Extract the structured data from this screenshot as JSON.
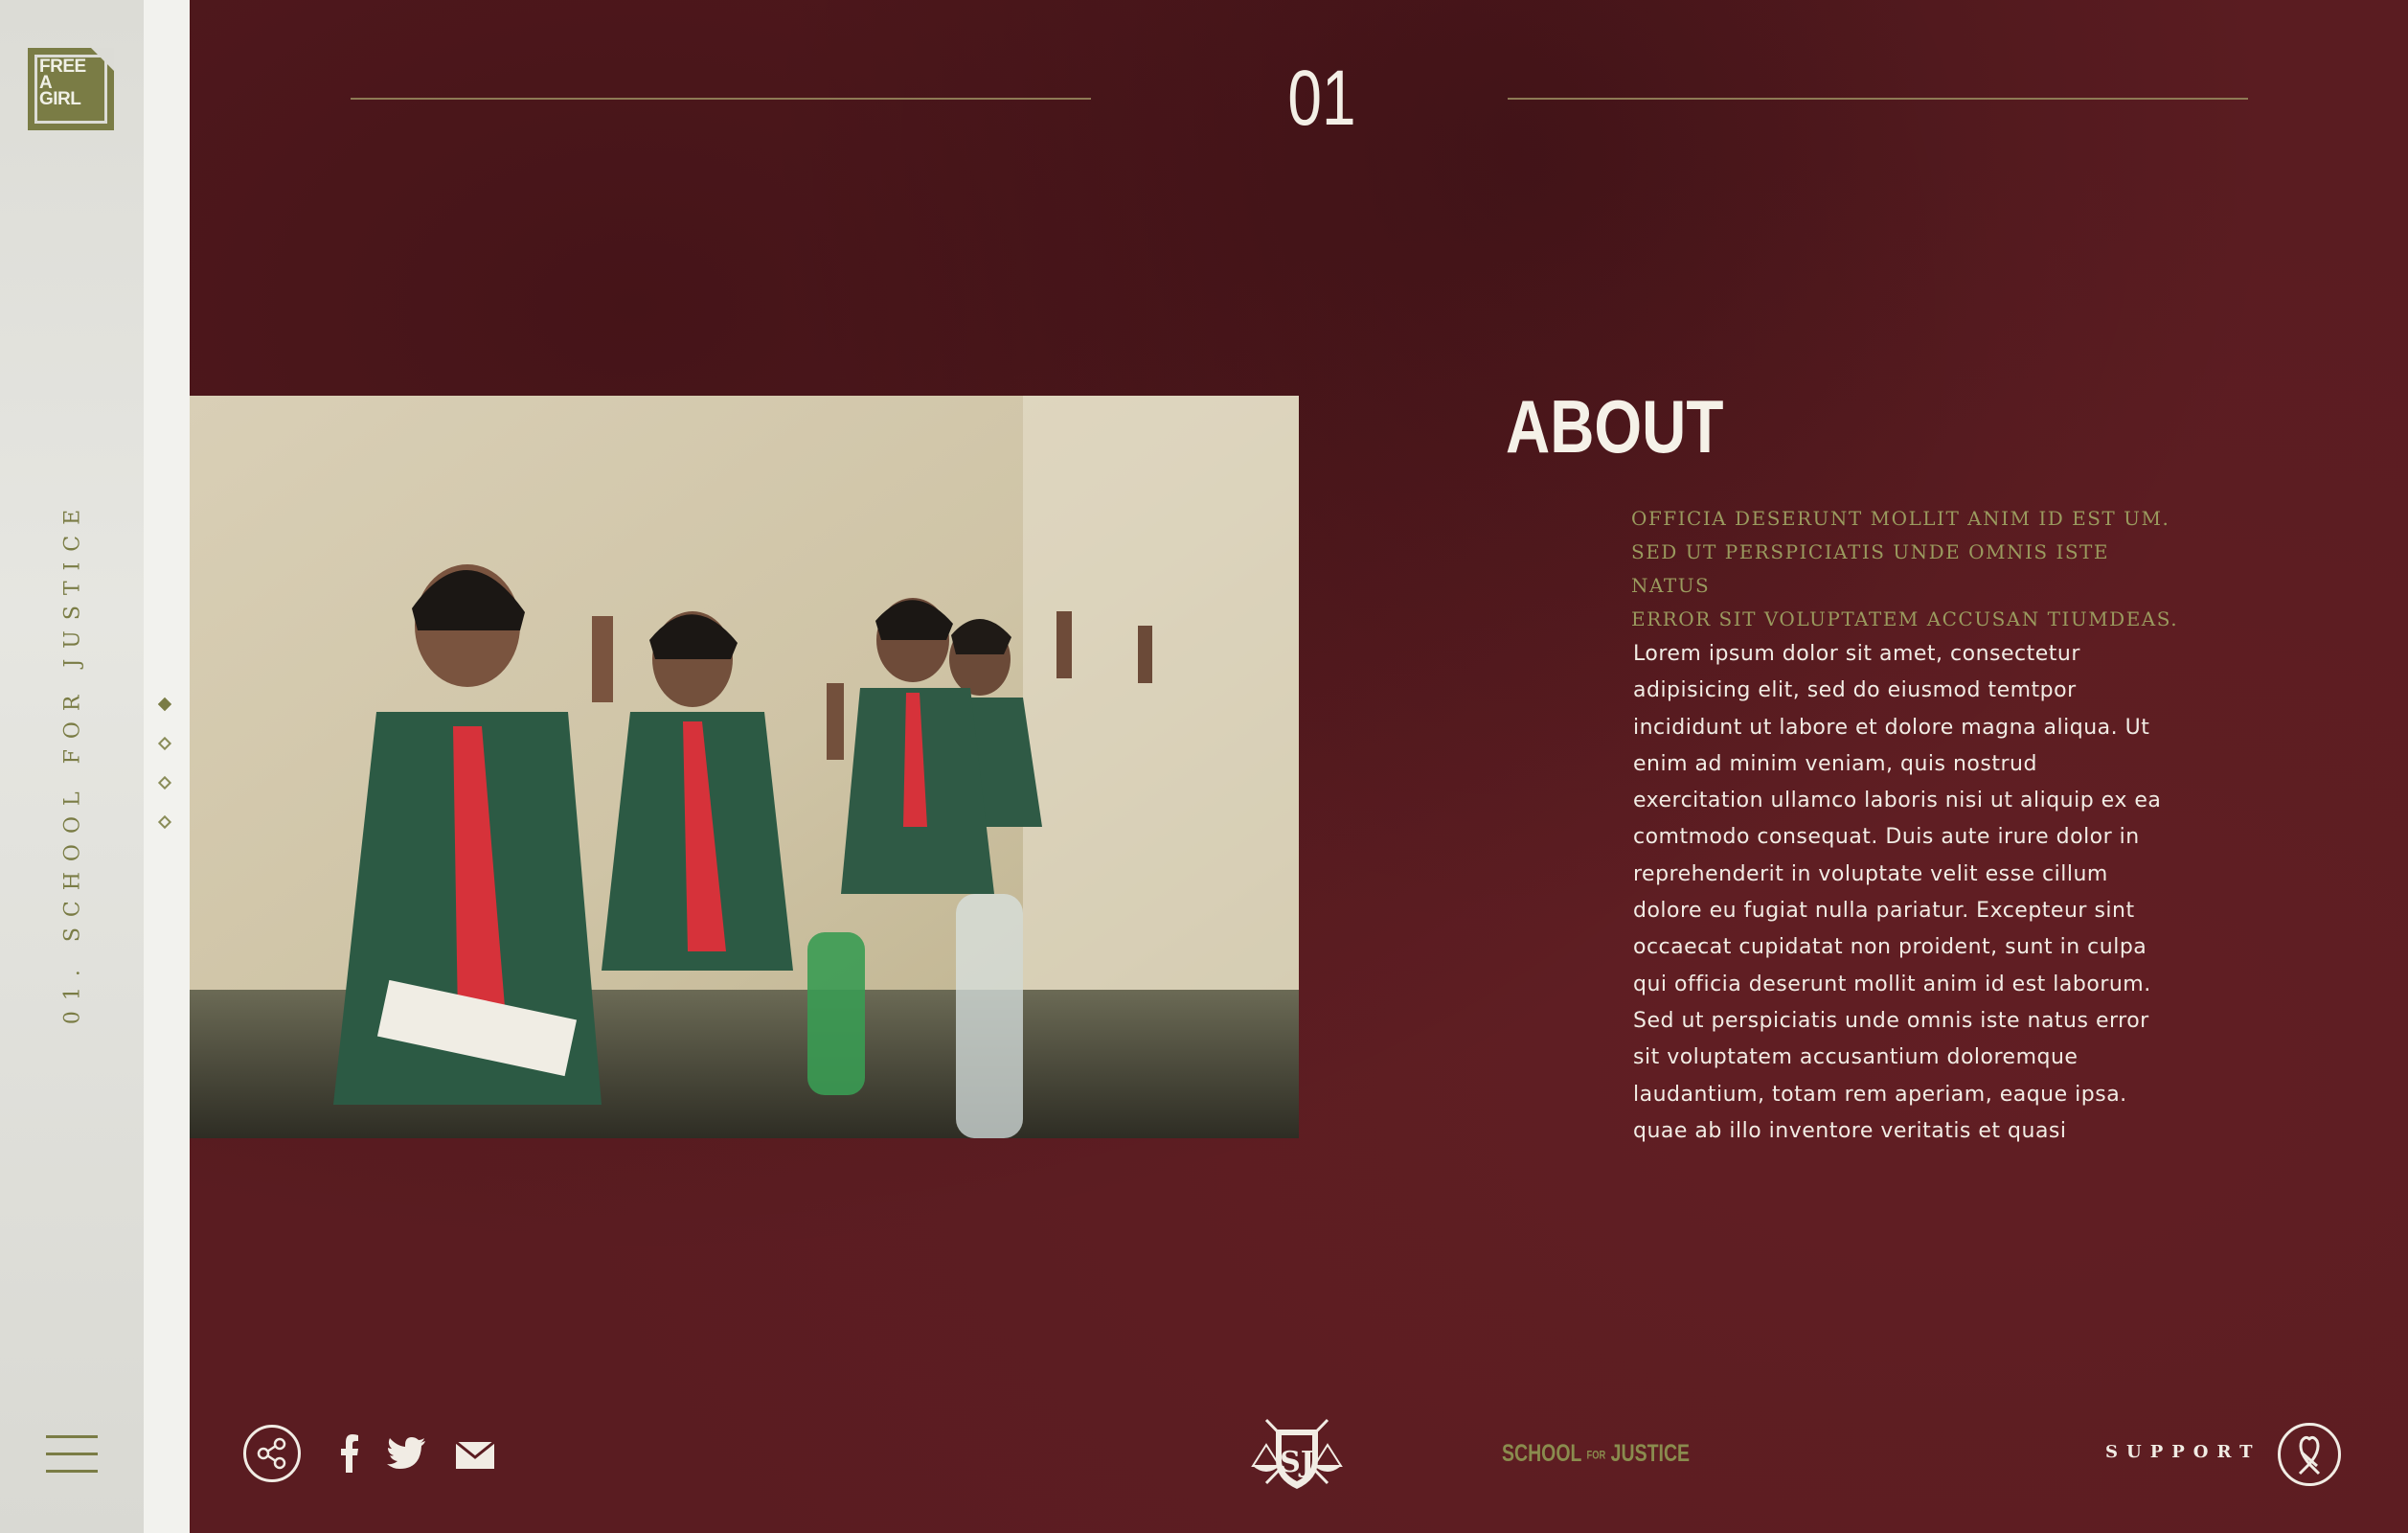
{
  "brand": {
    "logo_lines": [
      "FREE",
      "A",
      "GIRL"
    ],
    "accent_color": "#7a7c45",
    "background_color": "#5a1c21"
  },
  "sidebar": {
    "section_label": "01. SCHOOL FOR JUSTICE",
    "slide_dots": 4,
    "active_dot": 0,
    "menu_icon": "hamburger-menu-icon"
  },
  "header": {
    "slide_number": "01"
  },
  "content": {
    "title": "ABOUT",
    "lead_lines": [
      "Officia deserunt mollit anim id est um.",
      "Sed ut perspiciatis unde omnis iste natus",
      "error sit voluptatem accusan tiumdeas."
    ],
    "body_lines": [
      "Lorem ipsum dolor sit amet, consectetur",
      "adipisicing elit, sed do eiusmod temtpor",
      "incididunt ut labore et dolore magna aliqua. Ut",
      "enim ad minim veniam, quis nostrud",
      "exercitation ullamco laboris nisi ut aliquip ex ea",
      "comtmodo consequat. Duis aute irure dolor in",
      "reprehenderit in voluptate velit esse cillum",
      "dolore eu fugiat nulla pariatur. Excepteur sint",
      "occaecat cupidatat non proident, sunt in culpa",
      "qui officia deserunt mollit anim id est laborum.",
      "Sed ut perspiciatis unde omnis iste natus error",
      "sit voluptatem accusantium doloremque",
      "laudantium, totam rem aperiam, eaque ipsa.",
      "quae ab illo inventore veritatis et quasi"
    ]
  },
  "footer": {
    "share_icons": [
      "share-icon",
      "facebook-icon",
      "twitter-icon",
      "mail-icon"
    ],
    "crest_icon": "school-for-justice-crest-icon",
    "crest_letters": "SJ",
    "brand_text_1": "SCHOOL",
    "brand_text_for": "FOR",
    "brand_text_2": "JUSTICE",
    "support_label": "SUPPORT",
    "support_icon": "ribbon-icon"
  }
}
